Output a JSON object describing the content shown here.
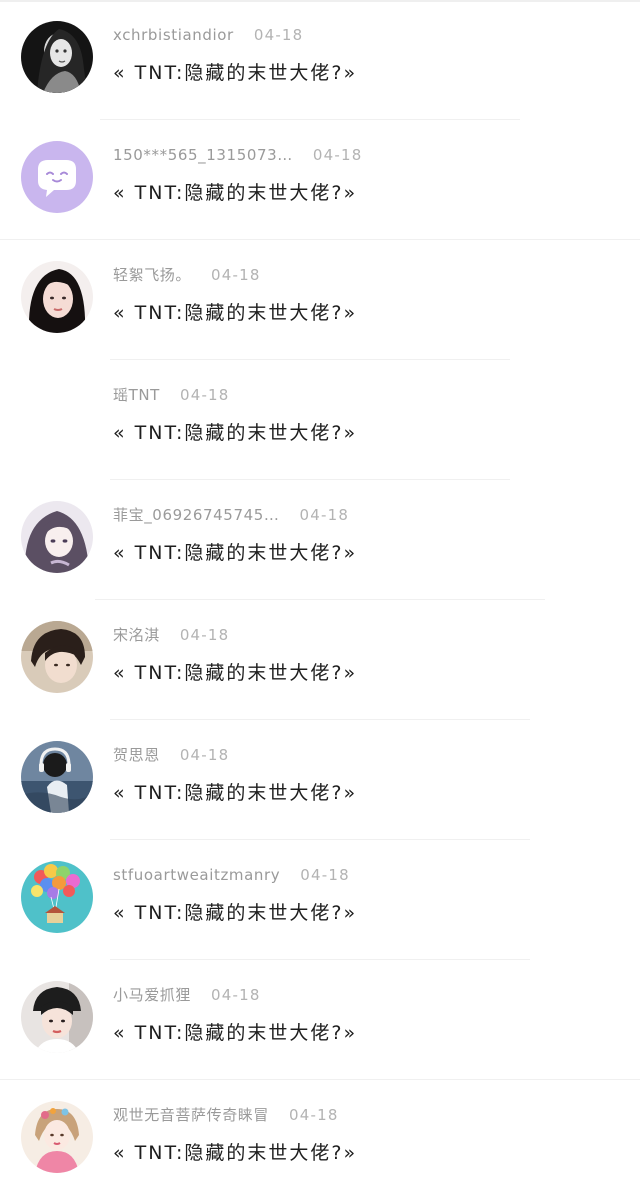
{
  "colors": {
    "username": "#9a9a9a",
    "date": "#b3b3b3",
    "title": "#1e1e1e",
    "divider": "#f0f0f0",
    "background": "#ffffff"
  },
  "comments": [
    {
      "username": "xchrbistiandior",
      "date": "04-18",
      "title": "« TNT:隐藏的末世大佬?»",
      "avatar_icon": "girl-dark-avatar-icon"
    },
    {
      "username": "150***565_1315073…",
      "date": "04-18",
      "title": "« TNT:隐藏的末世大佬?»",
      "avatar_icon": "purple-chat-bubble-avatar-icon"
    },
    {
      "username": "轻絮飞扬。",
      "date": "04-18",
      "title": "« TNT:隐藏的末世大佬?»",
      "avatar_icon": "girl-portrait-avatar-icon"
    },
    {
      "username": "瑶TNT",
      "date": "04-18",
      "title": "« TNT:隐藏的末世大佬?»",
      "avatar_icon": ""
    },
    {
      "username": "菲宝_06926745745…",
      "date": "04-18",
      "title": "« TNT:隐藏的末世大佬?»",
      "avatar_icon": "anime-girl-avatar-icon"
    },
    {
      "username": "宋洺淇",
      "date": "04-18",
      "title": "« TNT:隐藏的末世大佬?»",
      "avatar_icon": "boy-closeup-avatar-icon"
    },
    {
      "username": "贺思恩",
      "date": "04-18",
      "title": "« TNT:隐藏的末世大佬?»",
      "avatar_icon": "headphones-person-avatar-icon"
    },
    {
      "username": "stfuoartweaitzmanry",
      "date": "04-18",
      "title": "« TNT:隐藏的末世大佬?»",
      "avatar_icon": "balloon-house-avatar-icon"
    },
    {
      "username": "小马爱抓狸",
      "date": "04-18",
      "title": "« TNT:隐藏的末世大佬?»",
      "avatar_icon": "boy-with-hat-avatar-icon"
    },
    {
      "username": "观世无音菩萨传奇睐冒",
      "date": "04-18",
      "title": "« TNT:隐藏的末世大佬?»",
      "avatar_icon": "doll-pink-avatar-icon"
    }
  ]
}
